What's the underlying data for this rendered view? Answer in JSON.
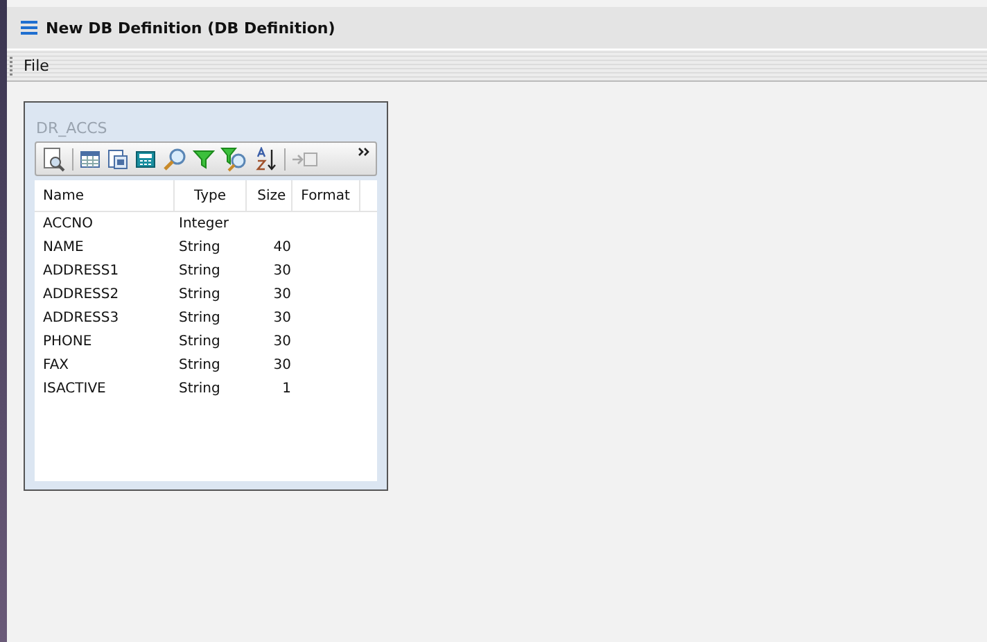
{
  "window": {
    "title": "New DB Definition (DB Definition)"
  },
  "menu": [
    "File"
  ],
  "panel": {
    "title": "DR_ACCS"
  },
  "table": {
    "columns": [
      "Name",
      "Type",
      "Size",
      "Format"
    ],
    "rows": [
      {
        "name": "ACCNO",
        "type": "Integer",
        "size": ""
      },
      {
        "name": "NAME",
        "type": "String",
        "size": "40"
      },
      {
        "name": "ADDRESS1",
        "type": "String",
        "size": "30"
      },
      {
        "name": "ADDRESS2",
        "type": "String",
        "size": "30"
      },
      {
        "name": "ADDRESS3",
        "type": "String",
        "size": "30"
      },
      {
        "name": "PHONE",
        "type": "String",
        "size": "30"
      },
      {
        "name": "FAX",
        "type": "String",
        "size": "30"
      },
      {
        "name": "ISACTIVE",
        "type": "String",
        "size": "1"
      }
    ]
  }
}
